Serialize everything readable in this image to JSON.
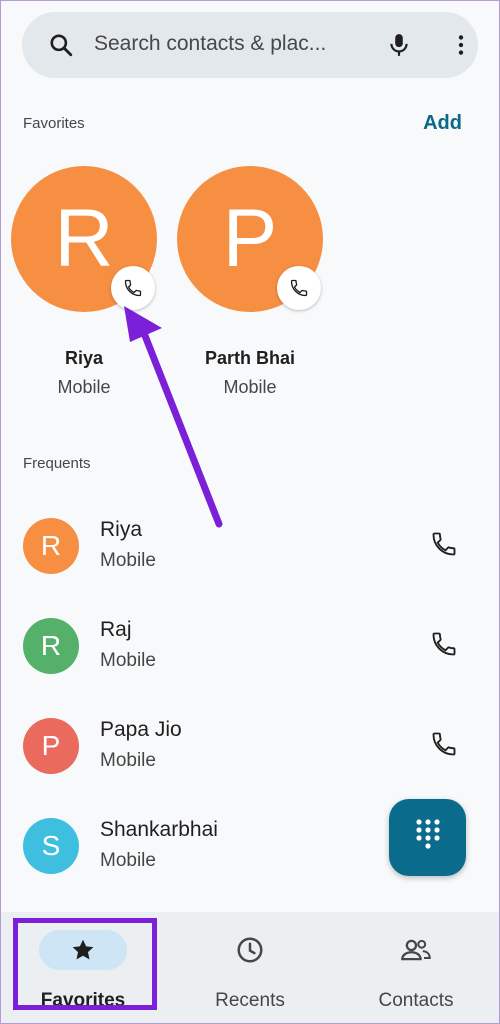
{
  "search": {
    "placeholder": "Search contacts & plac..."
  },
  "favorites": {
    "label": "Favorites",
    "add_label": "Add",
    "items": [
      {
        "initial": "R",
        "name": "Riya",
        "type": "Mobile"
      },
      {
        "initial": "P",
        "name": "Parth Bhai",
        "type": "Mobile"
      }
    ]
  },
  "frequents": {
    "label": "Frequents",
    "items": [
      {
        "initial": "R",
        "name": "Riya",
        "type": "Mobile",
        "color": "#f78f43"
      },
      {
        "initial": "R",
        "name": "Raj",
        "type": "Mobile",
        "color": "#55b16a"
      },
      {
        "initial": "P",
        "name": "Papa Jio",
        "type": "Mobile",
        "color": "#ea6a5e"
      },
      {
        "initial": "S",
        "name": "Shankarbhai",
        "type": "Mobile",
        "color": "#3fbfe0"
      }
    ]
  },
  "nav": {
    "favorites": "Favorites",
    "recents": "Recents",
    "contacts": "Contacts"
  },
  "colors": {
    "accent": "#0a6b8c",
    "annotation": "#7b1fd8",
    "favorite_avatar": "#f78f43"
  }
}
